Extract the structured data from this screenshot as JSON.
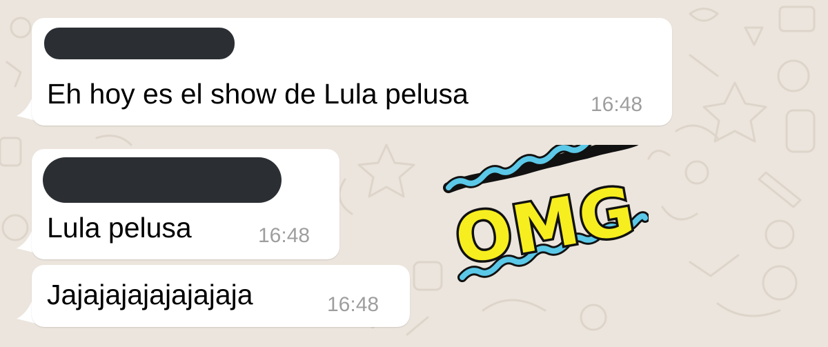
{
  "chat": {
    "wallpaper_color": "#ece5dd",
    "bubble_color": "#ffffff",
    "messages": [
      {
        "sender_redacted": true,
        "text": "Eh hoy es el show de Lula pelusa",
        "time": "16:48"
      },
      {
        "sender_redacted": true,
        "text": "Lula pelusa",
        "time": "16:48"
      },
      {
        "sender_redacted": false,
        "text": "Jajajajajajajajaja",
        "time": "16:48"
      }
    ],
    "sticker": {
      "text": "OMG",
      "text_color": "#f7ee1f",
      "wave_color": "#5bc8e8"
    }
  }
}
